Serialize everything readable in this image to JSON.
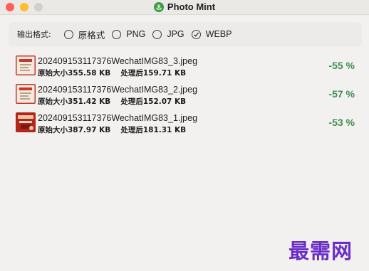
{
  "window": {
    "title": "Photo Mint"
  },
  "format": {
    "label": "输出格式:",
    "options": [
      {
        "label": "原格式",
        "checked": false
      },
      {
        "label": "PNG",
        "checked": false
      },
      {
        "label": "JPG",
        "checked": false
      },
      {
        "label": "WEBP",
        "checked": true
      }
    ]
  },
  "files": [
    {
      "name": "202409153117376WechatIMG83_3.jpeg",
      "original_label": "原始大小",
      "original_size": "355.58 KB",
      "processed_label": "处理后",
      "processed_size": "159.71 KB",
      "reduction": "-55 %"
    },
    {
      "name": "202409153117376WechatIMG83_2.jpeg",
      "original_label": "原始大小",
      "original_size": "351.42 KB",
      "processed_label": "处理后",
      "processed_size": "152.07 KB",
      "reduction": "-57 %"
    },
    {
      "name": "202409153117376WechatIMG83_1.jpeg",
      "original_label": "原始大小",
      "original_size": "387.97 KB",
      "processed_label": "处理后",
      "processed_size": "181.31 KB",
      "reduction": "-53 %"
    }
  ],
  "colors": {
    "accent_green": "#3e8e4e",
    "watermark": "#6a2ec9"
  },
  "watermark": "最需网"
}
